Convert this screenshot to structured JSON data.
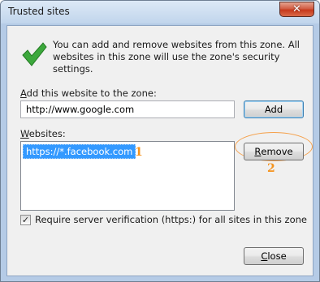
{
  "window": {
    "title": "Trusted sites",
    "close_glyph": "✕"
  },
  "intro": {
    "icon": "checkmark-icon",
    "text": "You can add and remove websites from this zone. All websites in this zone will use the zone's security settings."
  },
  "add_section": {
    "label_prefix": "A",
    "label_rest": "dd this website to the zone:",
    "input_value": "http://www.google.com",
    "add_button": "Add"
  },
  "websites": {
    "label_prefix": "W",
    "label_rest": "ebsites:",
    "items": [
      "https://*.facebook.com"
    ],
    "remove_prefix": "R",
    "remove_rest": "emove"
  },
  "annotations": {
    "one": "1",
    "two": "2",
    "color": "#f5931e"
  },
  "verification": {
    "checked": true,
    "check_glyph": "✓",
    "label": "Require server verification (https:) for all sites in this zone"
  },
  "footer": {
    "close_prefix": "C",
    "close_rest": "lose"
  }
}
